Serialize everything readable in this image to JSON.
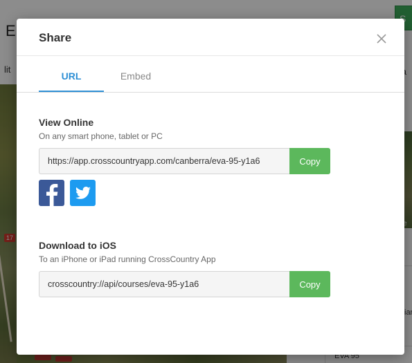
{
  "background": {
    "title_fragment": "E",
    "green_button_fragment": "S",
    "edit_fragment": "lit",
    "va_fragment": "Va",
    "marker_label": "17",
    "caption_fragment": "e",
    "ian_fragment": "ian",
    "eva_label": "EVA 95"
  },
  "modal": {
    "title": "Share",
    "close_label": "×",
    "tabs": [
      {
        "label": "URL",
        "active": true
      },
      {
        "label": "Embed",
        "active": false
      }
    ],
    "view_online": {
      "title": "View Online",
      "subtitle": "On any smart phone, tablet or PC",
      "url": "https://app.crosscountryapp.com/canberra/eva-95-y1a6",
      "copy_label": "Copy"
    },
    "social": [
      {
        "icon": "facebook-icon",
        "color": "#3b5998"
      },
      {
        "icon": "twitter-icon",
        "color": "#1d9bf0"
      }
    ],
    "download_ios": {
      "title": "Download to iOS",
      "subtitle": "To an iPhone or iPad running CrossCountry App",
      "url": "crosscountry://api/courses/eva-95-y1a6",
      "copy_label": "Copy"
    }
  },
  "colors": {
    "accent": "#2d8fd5",
    "copy_button": "#5cb85c",
    "overlay": "rgba(0,0,0,0.45)"
  }
}
